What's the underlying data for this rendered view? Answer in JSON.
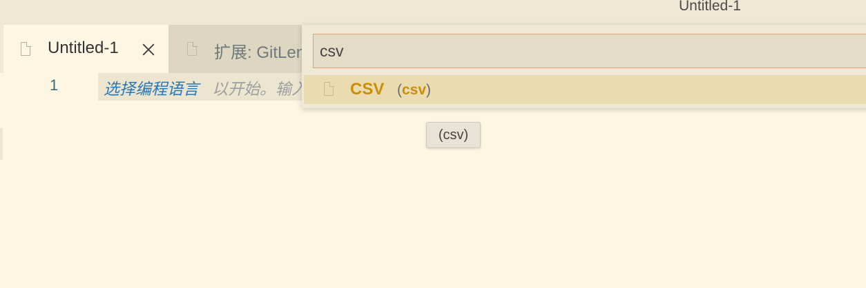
{
  "window": {
    "title": "Untitled-1"
  },
  "tabs": [
    {
      "label": "Untitled-1",
      "icon": "file-icon",
      "active": true
    },
    {
      "label": "扩展: GitLens",
      "icon": "file-icon",
      "active": false
    }
  ],
  "editor": {
    "line_number": "1",
    "hint_link": "选择编程语言",
    "hint_rest": "以开始。输入以"
  },
  "quick_pick": {
    "input_value": "csv",
    "items": [
      {
        "language": "CSV",
        "id_open": "(",
        "id": "csv",
        "id_close": ")",
        "icon": "file-icon"
      }
    ]
  },
  "tooltip": {
    "text": "(csv)"
  },
  "colors": {
    "background": "#fdf6e3",
    "accent": "#c98f0a",
    "link": "#2a78b6",
    "input_border": "#dfa37c"
  }
}
